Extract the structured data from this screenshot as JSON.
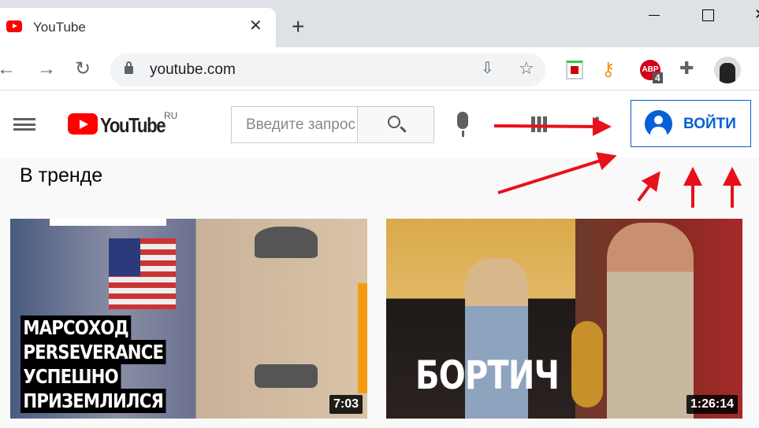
{
  "browser": {
    "tab_title": "YouTube",
    "url": "youtube.com",
    "abp_badge": "4"
  },
  "youtube": {
    "logo_text": "YouTube",
    "logo_region": "RU",
    "search_placeholder": "Введите запрос",
    "signin_label": "ВОЙТИ",
    "section_title": "В тренде"
  },
  "videos": [
    {
      "caption_lines": [
        "МАРСОХОД",
        "PERSEVERANCE",
        "УСПЕШНО",
        "ПРИЗЕМЛИЛСЯ"
      ],
      "duration": "7:03"
    },
    {
      "caption_lines": [
        "БОРТИЧ"
      ],
      "duration": "1:26:14"
    }
  ],
  "colors": {
    "youtube_red": "#ff0000",
    "signin_blue": "#065fd4",
    "annotation_red": "#e8101a"
  }
}
